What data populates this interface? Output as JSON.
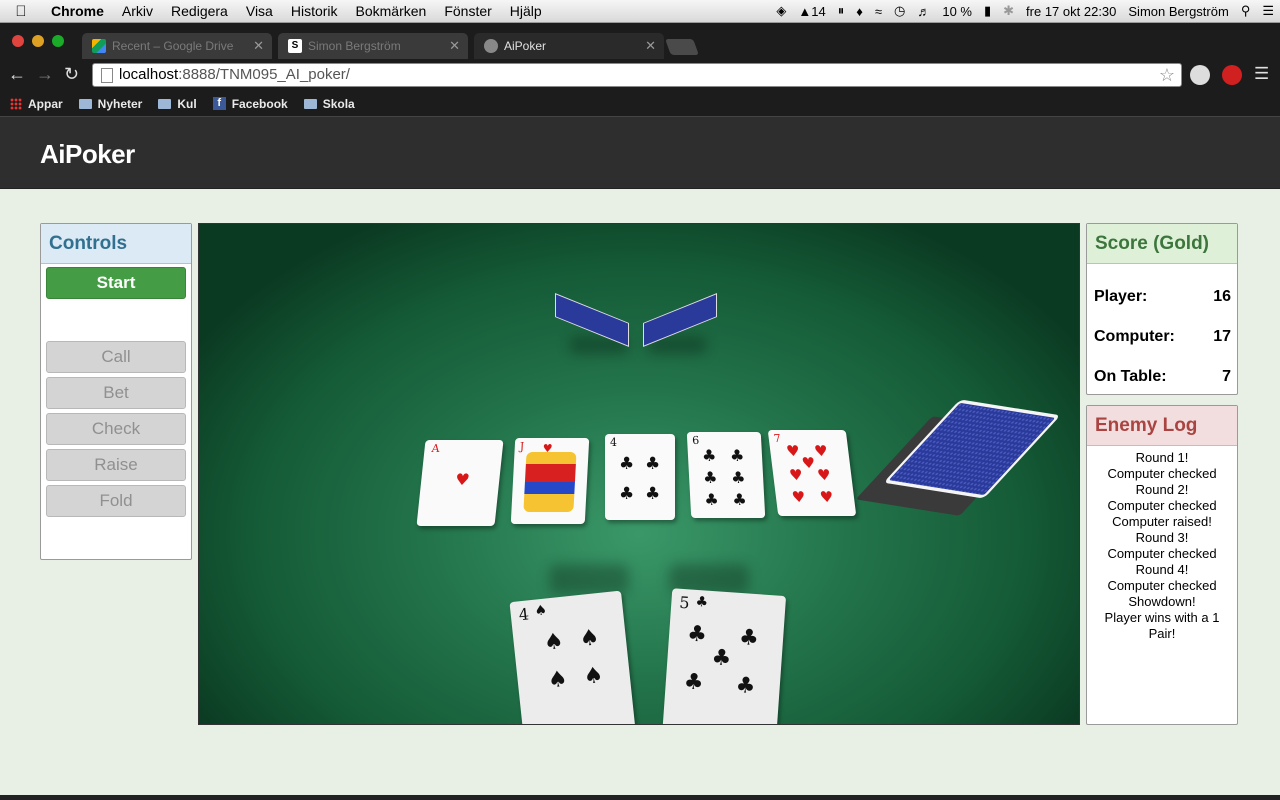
{
  "menubar": {
    "app": "Chrome",
    "items": [
      "Arkiv",
      "Redigera",
      "Visa",
      "Historik",
      "Bokmärken",
      "Fönster",
      "Hjälp"
    ],
    "status_count": "14",
    "battery": "10 %",
    "clock": "fre 17 okt  22:30",
    "user": "Simon Bergström"
  },
  "browser": {
    "tabs": [
      {
        "title": "Recent – Google Drive"
      },
      {
        "title": "Simon Bergström"
      },
      {
        "title": "AiPoker"
      }
    ],
    "url_host": "localhost",
    "url_path": ":8888/TNM095_AI_poker/",
    "bookmarks": [
      "Appar",
      "Nyheter",
      "Kul",
      "Facebook",
      "Skola"
    ]
  },
  "app": {
    "brand": "AiPoker"
  },
  "controls": {
    "title": "Controls",
    "start": "Start",
    "call": "Call",
    "bet": "Bet",
    "check": "Check",
    "raise": "Raise",
    "fold": "Fold"
  },
  "score": {
    "title": "Score (Gold)",
    "rows": [
      {
        "label": "Player:",
        "value": "16"
      },
      {
        "label": "Computer:",
        "value": "17"
      },
      {
        "label": "On Table:",
        "value": "7"
      }
    ]
  },
  "enemy_log": {
    "title": "Enemy Log",
    "lines": [
      "Round 1!",
      "Computer checked",
      "Round 2!",
      "Computer checked",
      "Computer raised!",
      "Round 3!",
      "Computer checked",
      "Round 4!",
      "Computer checked",
      "Showdown!",
      "Player wins with a 1 Pair!"
    ]
  },
  "community_cards": [
    {
      "rank": "A",
      "suit": "♥"
    },
    {
      "rank": "J",
      "suit": "♥"
    },
    {
      "rank": "4",
      "suit": "♣"
    },
    {
      "rank": "6",
      "suit": "♣"
    },
    {
      "rank": "7",
      "suit": "♥"
    }
  ],
  "player_cards": [
    {
      "rank": "4",
      "suit": "♠"
    },
    {
      "rank": "5",
      "suit": "♣"
    }
  ],
  "colors": {
    "start_green": "#449d44",
    "felt": "#23744b",
    "card_back": "#2a3a9a"
  }
}
